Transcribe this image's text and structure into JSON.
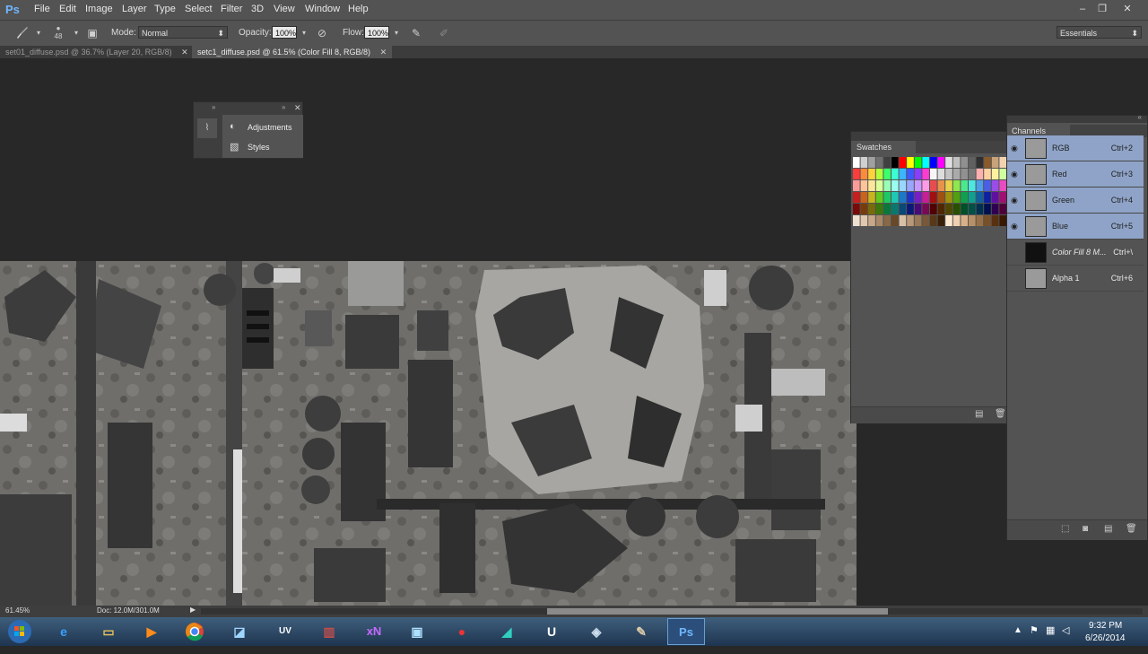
{
  "app": {
    "logo": "Ps"
  },
  "menu": [
    "File",
    "Edit",
    "Image",
    "Layer",
    "Type",
    "Select",
    "Filter",
    "3D",
    "View",
    "Window",
    "Help"
  ],
  "window_controls": {
    "minimize": "–",
    "restore": "❐",
    "close": "✕"
  },
  "options": {
    "brush_size": "48",
    "mode_label": "Mode:",
    "mode_value": "Normal",
    "opacity_label": "Opacity:",
    "opacity_value": "100%",
    "flow_label": "Flow:",
    "flow_value": "100%",
    "workspace": "Essentials"
  },
  "tabs": [
    {
      "label": "set01_diffuse.psd @ 36.7% (Layer 20, RGB/8)",
      "active": false
    },
    {
      "label": "setc1_diffuse.psd @ 61.5% (Color Fill 8, RGB/8)",
      "active": true
    }
  ],
  "tab_close": "✕",
  "mini_panel": {
    "items": [
      "Adjustments",
      "Styles"
    ]
  },
  "swatches": {
    "title": "Swatches"
  },
  "channels": {
    "title": "Channels",
    "rows": [
      {
        "name": "RGB",
        "key": "Ctrl+2",
        "selected": true
      },
      {
        "name": "Red",
        "key": "Ctrl+3",
        "selected": true
      },
      {
        "name": "Green",
        "key": "Ctrl+4",
        "selected": true
      },
      {
        "name": "Blue",
        "key": "Ctrl+5",
        "selected": true
      },
      {
        "name": "Color Fill 8 M...",
        "key": "Ctrl+\\",
        "selected": false
      },
      {
        "name": "Alpha 1",
        "key": "Ctrl+6",
        "selected": false
      }
    ]
  },
  "status": {
    "zoom": "61.45%",
    "doc": "Doc: 12.0M/301.0M"
  },
  "taskbar": {
    "clock_time": "9:32 PM",
    "clock_date": "6/26/2014",
    "icons": [
      "start-orb",
      "internet-explorer",
      "file-explorer",
      "media-player",
      "chrome",
      "notepad",
      "uv-layout",
      "winrar",
      "xnview",
      "screenshot",
      "blender",
      "3ds-max",
      "unreal-engine",
      "ue-editor",
      "utility",
      "photoshop"
    ]
  },
  "colors": {
    "accent": "#2d6fa8",
    "selected_row": "#8ea3c7"
  }
}
